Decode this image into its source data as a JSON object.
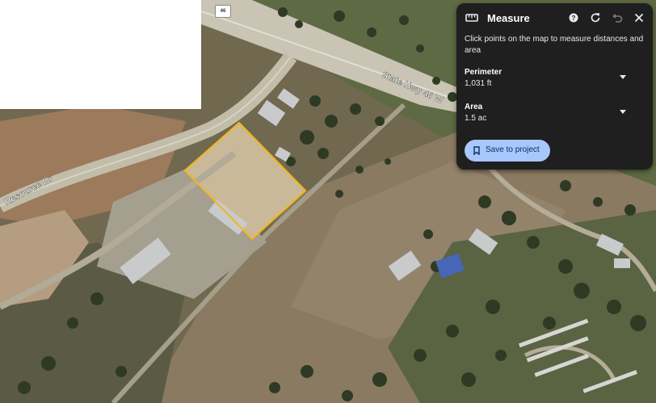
{
  "map": {
    "highway_shield": "46",
    "road_labels": {
      "highway": "State Hwy 46 W",
      "side_road": "Resource Dr"
    }
  },
  "measure_panel": {
    "title": "Measure",
    "instructions": "Click points on the map to measure distances and area",
    "perimeter": {
      "label": "Perimeter",
      "value": "1,031 ft"
    },
    "area": {
      "label": "Area",
      "value": "1.5 ac"
    },
    "save_button": "Save to project",
    "icons": {
      "title": "ruler-icon",
      "help": "help-icon",
      "reset": "refresh-icon",
      "undo": "undo-icon",
      "close": "close-icon",
      "expand": "chevron-down-icon",
      "save": "bookmark-icon"
    }
  },
  "colors": {
    "measure_outline": "#f5b51a",
    "panel_bg": "#1f1f1f",
    "button_bg": "#a8c7fa"
  }
}
